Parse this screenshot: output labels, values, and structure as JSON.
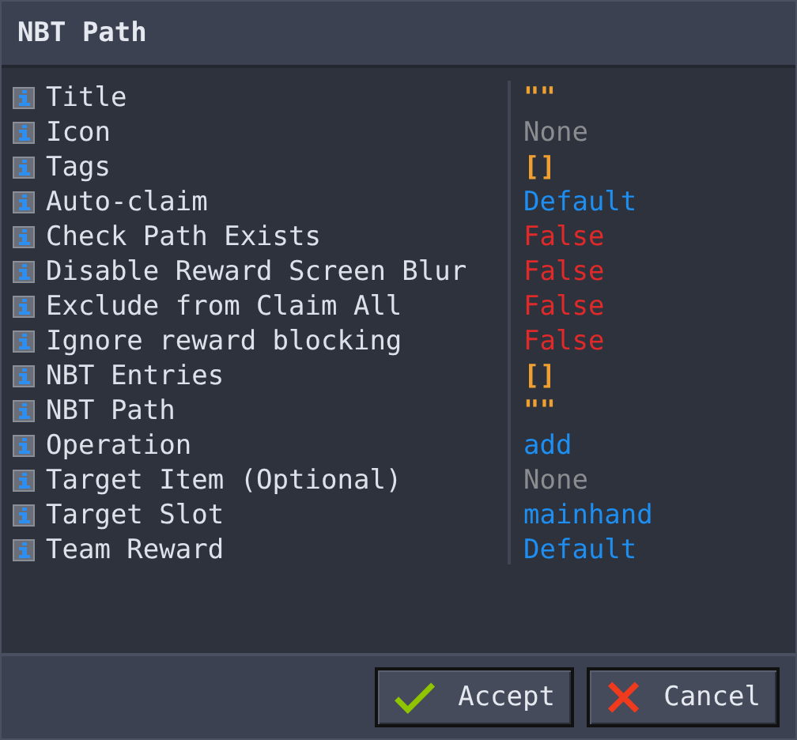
{
  "window": {
    "title": "NBT Path"
  },
  "properties": [
    {
      "label": "Title",
      "kind": "string",
      "value": "\"\""
    },
    {
      "label": "Icon",
      "kind": "none",
      "value": "None"
    },
    {
      "label": "Tags",
      "kind": "list",
      "value": "[]"
    },
    {
      "label": "Auto-claim",
      "kind": "enum",
      "value": "Default"
    },
    {
      "label": "Check Path Exists",
      "kind": "bool",
      "value": "False"
    },
    {
      "label": "Disable Reward Screen Blur",
      "kind": "bool",
      "value": "False"
    },
    {
      "label": "Exclude from Claim All",
      "kind": "bool",
      "value": "False"
    },
    {
      "label": "Ignore reward blocking",
      "kind": "bool",
      "value": "False"
    },
    {
      "label": "NBT Entries",
      "kind": "list",
      "value": "[]"
    },
    {
      "label": "NBT Path",
      "kind": "string",
      "value": "\"\""
    },
    {
      "label": "Operation",
      "kind": "enum",
      "value": "add"
    },
    {
      "label": "Target Item (Optional)",
      "kind": "none",
      "value": "None"
    },
    {
      "label": "Target Slot",
      "kind": "enum",
      "value": "mainhand"
    },
    {
      "label": "Team Reward",
      "kind": "enum",
      "value": "Default"
    }
  ],
  "buttons": [
    {
      "label": "Accept",
      "kind": "accept"
    },
    {
      "label": "Cancel",
      "kind": "cancel"
    }
  ]
}
